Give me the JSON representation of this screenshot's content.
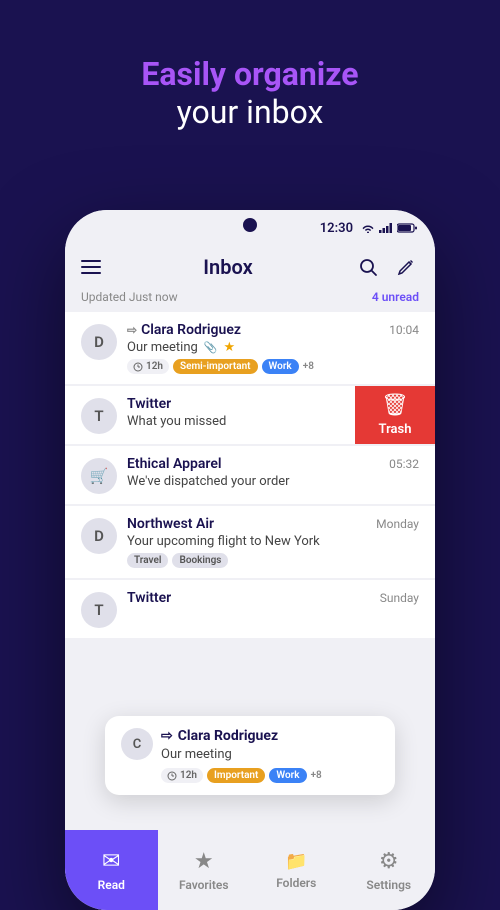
{
  "hero": {
    "line1": "Easily organize",
    "line2": "your inbox"
  },
  "status_bar": {
    "time": "12:30"
  },
  "header": {
    "title": "Inbox",
    "unread_text": "4 unread",
    "updated_text": "Updated Just now"
  },
  "emails": [
    {
      "id": "clara1",
      "avatar_letter": "D",
      "sender": "Clara Rodriguez",
      "time": "10:04",
      "subject": "Our meeting",
      "has_attachment": true,
      "has_star": true,
      "tags": [
        {
          "label": "12h",
          "type": "timer"
        },
        {
          "label": "Semi-important",
          "type": "semi-important"
        },
        {
          "label": "Work",
          "type": "work"
        },
        {
          "label": "+8",
          "type": "more"
        }
      ]
    },
    {
      "id": "twitter",
      "avatar_letter": "T",
      "sender": "Twitter",
      "time": "",
      "subject": "What you missed",
      "tags": [],
      "swipe_action": "trash"
    },
    {
      "id": "ethical",
      "avatar_letter": "🛒",
      "sender": "Ethical Apparel",
      "time": "05:32",
      "subject": "We've dispatched your order",
      "tags": []
    },
    {
      "id": "northwest",
      "avatar_letter": "D",
      "sender": "Northwest Air",
      "time": "Monday",
      "subject": "Your upcoming flight to New York",
      "tags": [
        {
          "label": "Travel",
          "type": "travel"
        },
        {
          "label": "Bookings",
          "type": "bookings"
        }
      ]
    },
    {
      "id": "twitter2",
      "avatar_letter": "T",
      "sender": "Twitter",
      "time": "Sunday",
      "subject": "",
      "tags": []
    }
  ],
  "swipe": {
    "trash_label": "Trash",
    "trash_icon": "🗑"
  },
  "tooltip": {
    "avatar_letter": "C",
    "sender": "Clara Rodriguez",
    "subject": "Our meeting",
    "timer": "12h",
    "tags": [
      {
        "label": "Important",
        "type": "important"
      },
      {
        "label": "Work",
        "type": "work"
      },
      {
        "label": "+8",
        "type": "more"
      }
    ]
  },
  "bottom_nav": [
    {
      "icon": "✉",
      "label": "Read",
      "active": true
    },
    {
      "icon": "★",
      "label": "Favorites",
      "active": false
    },
    {
      "icon": "📁",
      "label": "Folders",
      "active": false
    },
    {
      "icon": "⚙",
      "label": "Settings",
      "active": false
    }
  ]
}
